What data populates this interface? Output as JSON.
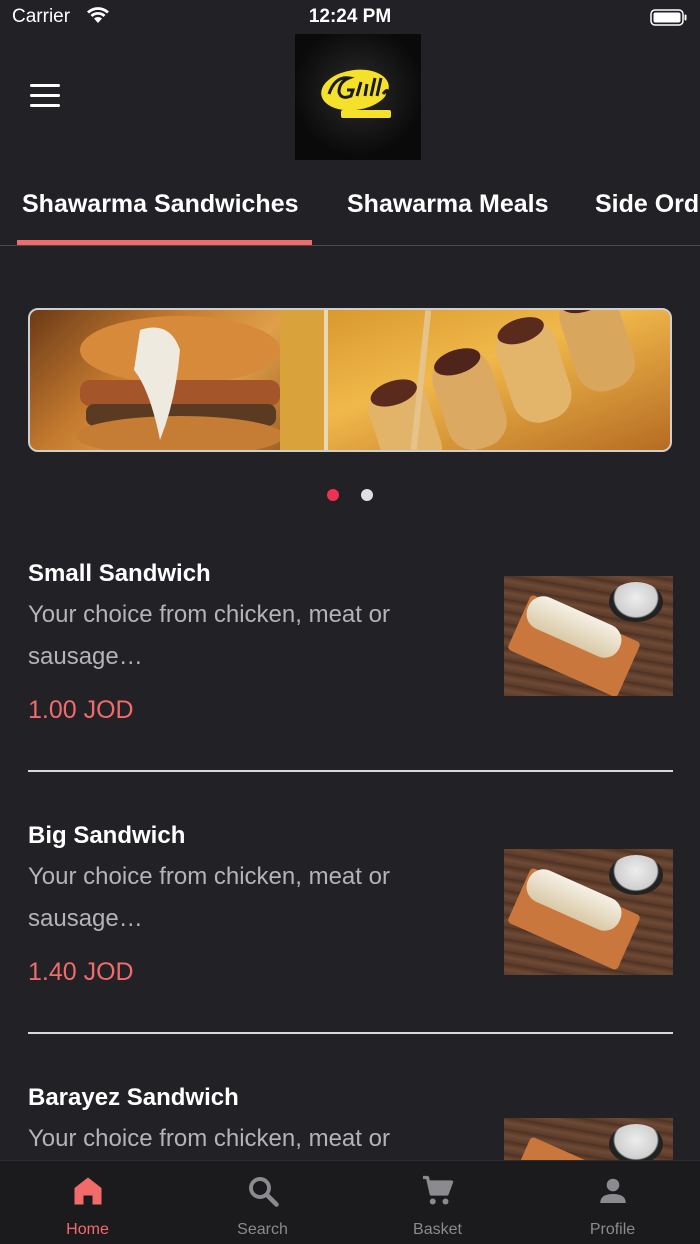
{
  "status_bar": {
    "carrier": "Carrier",
    "time": "12:24 PM"
  },
  "header": {
    "logo_text": "Grillo"
  },
  "tabs": [
    {
      "label": "Shawarma Sandwiches",
      "active": true
    },
    {
      "label": "Shawarma Meals",
      "active": false
    },
    {
      "label": "Side Orders",
      "active": false
    }
  ],
  "carousel": {
    "slides": 2,
    "active_index": 0
  },
  "products": [
    {
      "name": "Small Sandwich",
      "description": "Your choice from chicken, meat or sausage…",
      "price": "1.00 JOD"
    },
    {
      "name": "Big Sandwich",
      "description": "Your choice from chicken, meat or sausage…",
      "price": "1.40 JOD"
    },
    {
      "name": "Barayez Sandwich",
      "description": "Your choice from chicken, meat or",
      "price": ""
    }
  ],
  "bottom_nav": [
    {
      "label": "Home",
      "icon": "home-icon",
      "active": true
    },
    {
      "label": "Search",
      "icon": "search-icon",
      "active": false
    },
    {
      "label": "Basket",
      "icon": "cart-icon",
      "active": false
    },
    {
      "label": "Profile",
      "icon": "person-icon",
      "active": false
    }
  ],
  "colors": {
    "accent": "#f26b6b",
    "background": "#212126",
    "inactive": "#8a8a8f"
  }
}
